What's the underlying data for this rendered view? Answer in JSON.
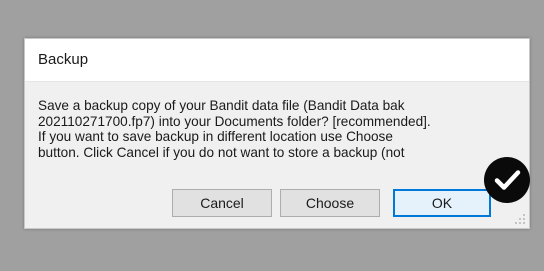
{
  "dialog": {
    "title": "Backup",
    "message_lines": [
      "Save a backup copy of your Bandit data file (Bandit Data bak",
      "202110271700.fp7) into your Documents folder? [recommended].",
      "If you want to save backup in different location use Choose",
      "button. Click Cancel if you do not want to store a backup (not"
    ],
    "buttons": {
      "cancel": "Cancel",
      "choose": "Choose",
      "ok": "OK"
    }
  },
  "icons": {
    "check_badge": "checkmark-icon",
    "resize_grip": "resize-grip-icon"
  },
  "colors": {
    "backdrop": "#a0a0a0",
    "dialog_bg": "#f0f0f0",
    "titlebar_bg": "#ffffff",
    "default_button_border": "#0078d7",
    "badge": "#0a0a0a"
  }
}
